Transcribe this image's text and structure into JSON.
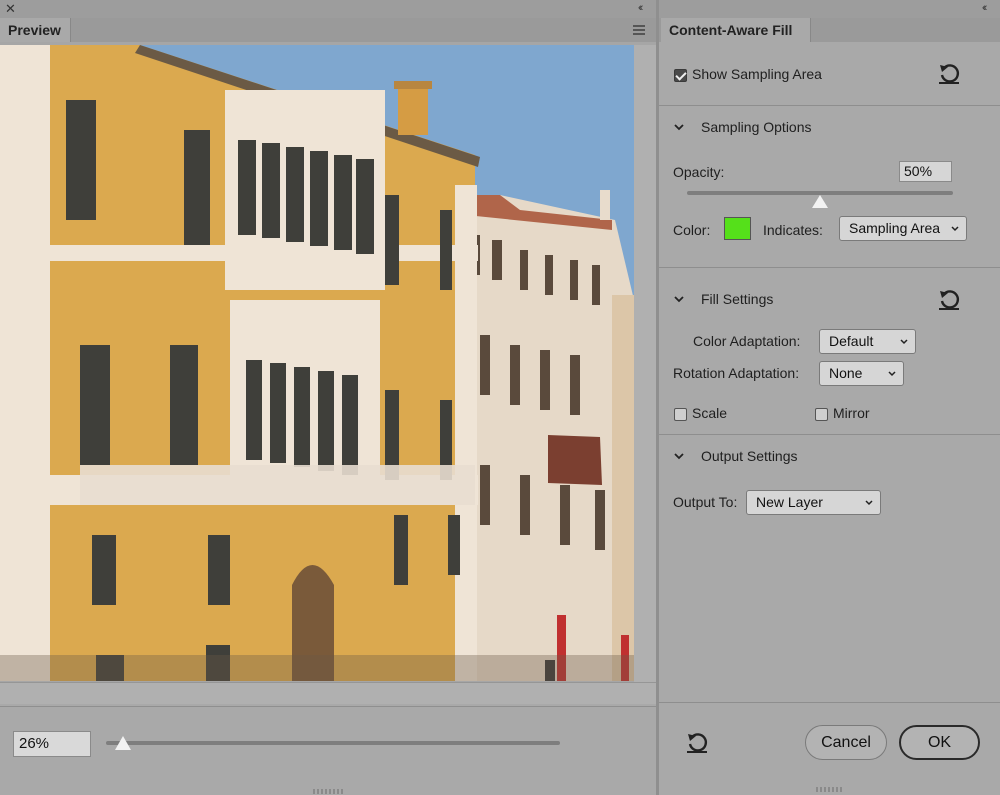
{
  "window": {
    "close_glyph": "✕",
    "collapse_glyph": "‹‹"
  },
  "preview": {
    "tab_label": "Preview",
    "zoom_value": "26%",
    "zoom_level_percent": 26
  },
  "content_aware_fill": {
    "tab_label": "Content-Aware Fill",
    "show_sampling_area": {
      "label": "Show Sampling Area",
      "checked": true
    },
    "sampling_options": {
      "header": "Sampling Options",
      "opacity_label": "Opacity:",
      "opacity_value": "50%",
      "opacity_percent": 50,
      "color_label": "Color:",
      "color_swatch": "#55e01a",
      "indicates_label": "Indicates:",
      "indicates_value": "Sampling Area"
    },
    "fill_settings": {
      "header": "Fill Settings",
      "color_adaptation_label": "Color Adaptation:",
      "color_adaptation_value": "Default",
      "rotation_adaptation_label": "Rotation Adaptation:",
      "rotation_adaptation_value": "None",
      "scale_label": "Scale",
      "scale_checked": false,
      "mirror_label": "Mirror",
      "mirror_checked": false
    },
    "output_settings": {
      "header": "Output Settings",
      "output_to_label": "Output To:",
      "output_to_value": "New Layer"
    },
    "buttons": {
      "cancel": "Cancel",
      "ok": "OK"
    }
  },
  "colors": {
    "panel_bg": "#a9a9a9",
    "sky": "#7fa7cf",
    "facade_ochre": "#dba94f",
    "facade_white": "#efe4d6",
    "sampling_green": "#55e01a"
  },
  "icons": {
    "reset": "reset-icon",
    "chevron": "chevron-down-icon",
    "menu": "panel-menu-icon"
  }
}
